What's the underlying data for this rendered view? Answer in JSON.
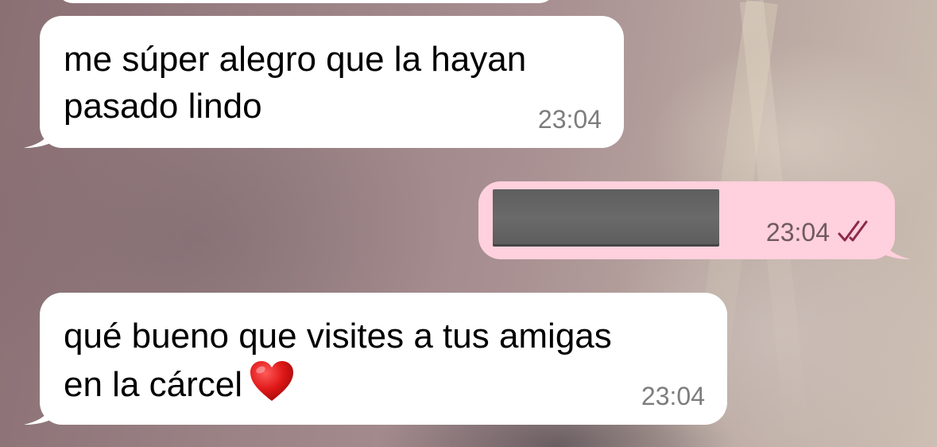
{
  "conversation": {
    "messages": [
      {
        "direction": "incoming",
        "text": "me súper alegro que la hayan\npasado lindo",
        "time": "23:04"
      },
      {
        "direction": "outgoing",
        "text": "",
        "redacted": true,
        "time": "23:04",
        "status_icon": "double-check-icon"
      },
      {
        "direction": "incoming",
        "text": "qué bueno que visites a tus amigas\nen la cárcel",
        "emoji": "red-heart-emoji",
        "time": "23:04"
      }
    ]
  },
  "colors": {
    "incoming_bubble": "#ffffff",
    "outgoing_bubble": "#ffd0dd",
    "timestamp": "#7d7d7d",
    "read_check": "#8c2a46",
    "redacted": "#636363"
  }
}
